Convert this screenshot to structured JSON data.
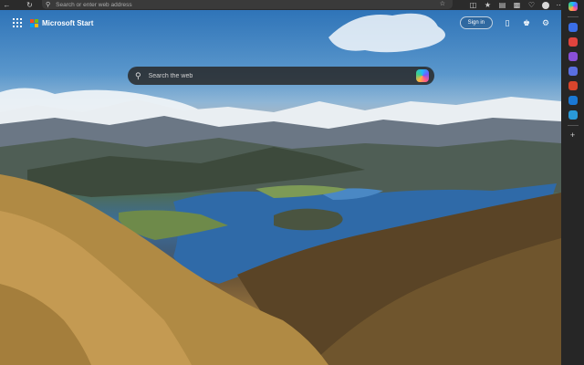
{
  "browser": {
    "address_placeholder": "Search or enter web address"
  },
  "header": {
    "brand": "Microsoft Start",
    "signin_label": "Sign in"
  },
  "search": {
    "placeholder": "Search the web"
  },
  "colors": {
    "logo_red": "#f25022",
    "logo_green": "#7fba00",
    "logo_blue": "#00a4ef",
    "logo_yellow": "#ffb900",
    "sidebar_bg": "#262626",
    "topbar_bg": "#2b2b2b"
  },
  "icons": {
    "topbar_left": [
      "back-icon",
      "refresh-icon",
      "home-icon"
    ],
    "topbar_right": [
      "split-screen-icon",
      "favorites-icon",
      "collections-icon",
      "extensions-icon",
      "browser-essentials-icon",
      "profile-icon",
      "more-icon"
    ],
    "header_right": [
      "mobile-icon",
      "rewards-icon",
      "settings-icon"
    ],
    "sidebar": [
      "copilot-icon",
      "search-icon",
      "shopping-icon",
      "tools-icon",
      "games-icon",
      "office-icon",
      "outlook-icon",
      "add-icon"
    ]
  }
}
